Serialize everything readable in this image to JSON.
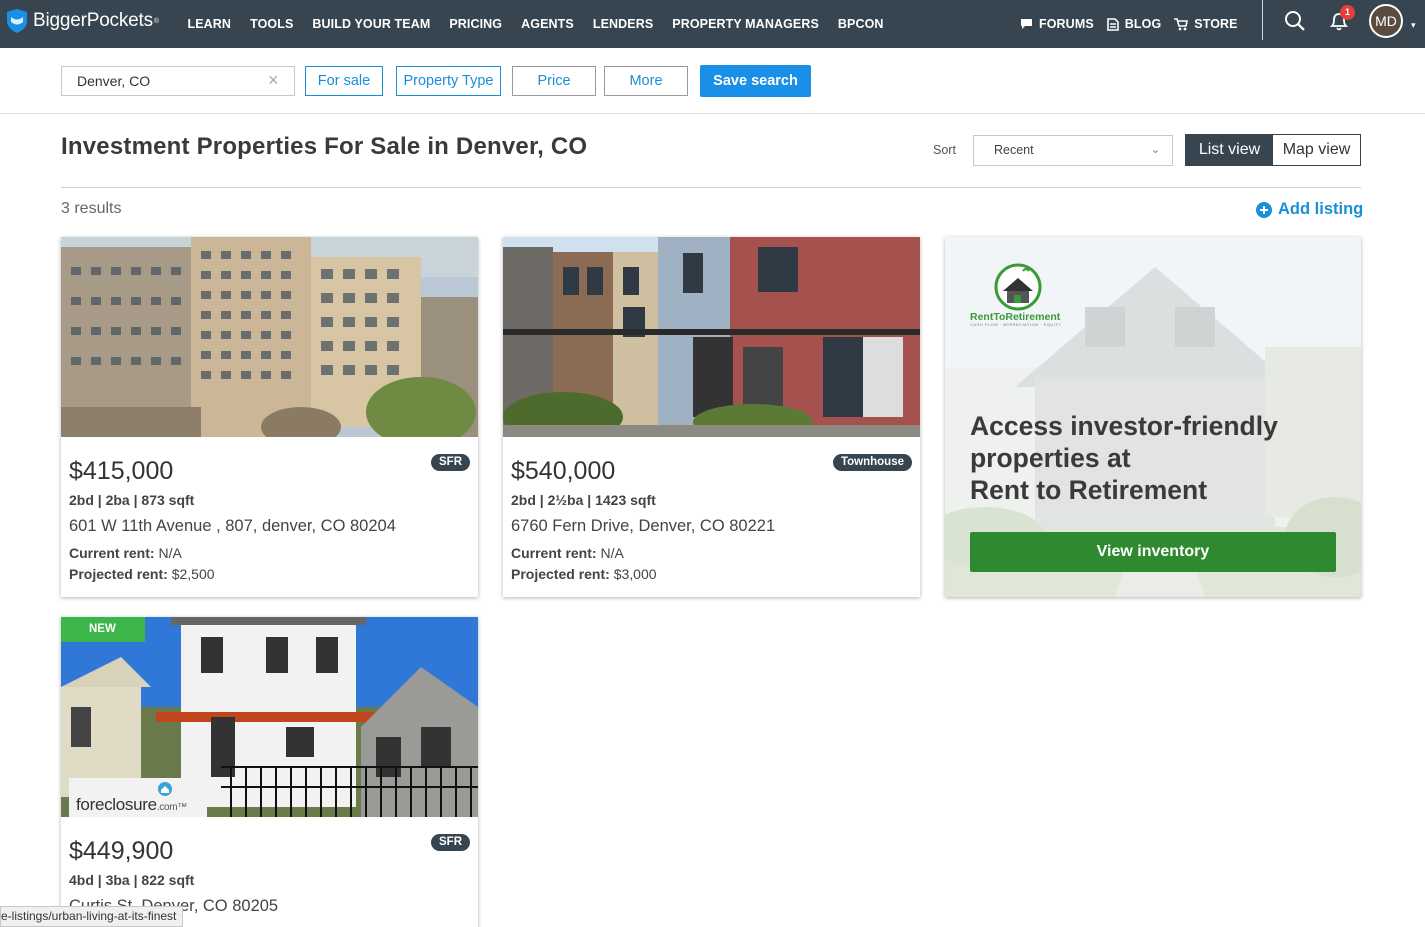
{
  "brand": {
    "name": "BiggerPockets",
    "reg": "®",
    "shield_color": "#1a8fe8"
  },
  "nav": {
    "links": [
      "LEARN",
      "TOOLS",
      "BUILD YOUR TEAM",
      "PRICING",
      "AGENTS",
      "LENDERS",
      "PROPERTY MANAGERS",
      "BPCON"
    ],
    "right_links": [
      {
        "label": "FORUMS",
        "icon": "chat-icon"
      },
      {
        "label": "BLOG",
        "icon": "document-icon"
      },
      {
        "label": "STORE",
        "icon": "cart-icon"
      }
    ],
    "notification_count": "1",
    "avatar_initials": "MD"
  },
  "filters": {
    "location_value": "Denver, CO",
    "for_sale": "For sale",
    "property_type": "Property Type",
    "price": "Price",
    "more": "More",
    "save_search": "Save search"
  },
  "page": {
    "title": "Investment Properties For Sale in Denver, CO",
    "sort_label": "Sort",
    "sort_value": "Recent",
    "list_view": "List view",
    "map_view": "Map view",
    "results": "3 results",
    "add_listing": "Add listing"
  },
  "listings": [
    {
      "price": "$415,000",
      "type": "SFR",
      "specs": "2bd | 2ba | 873 sqft",
      "address": "601 W 11th Avenue , 807, denver, CO 80204",
      "current_rent_label": "Current rent:",
      "current_rent": "N/A",
      "projected_rent_label": "Projected rent:",
      "projected_rent": "$2,500"
    },
    {
      "price": "$540,000",
      "type": "Townhouse",
      "specs": "2bd | 2½ba | 1423 sqft",
      "address": "6760 Fern Drive, Denver, CO 80221",
      "current_rent_label": "Current rent:",
      "current_rent": "N/A",
      "projected_rent_label": "Projected rent:",
      "projected_rent": "$3,000"
    },
    {
      "price": "$449,900",
      "type": "SFR",
      "new_label": "NEW",
      "specs": "4bd | 3ba | 822 sqft",
      "address": "Curtis St, Denver, CO 80205",
      "partner_logo": "foreclosure",
      "partner_logo_suffix": ".com™"
    }
  ],
  "ad": {
    "logo_name": "RentToRetirement",
    "logo_tagline": "CASH FLOW · APPRECIATION · EQUITY",
    "headline_line1": "Access investor-friendly",
    "headline_line2": "properties at",
    "headline_line3": "Rent to Retirement",
    "button": "View inventory",
    "button_color": "#2f8a2f"
  },
  "statusbar": {
    "url": "e-listings/urban-living-at-its-finest"
  },
  "colors": {
    "nav_bg": "#36454f",
    "accent_blue": "#1a8fe8",
    "new_green": "#3cb54a"
  }
}
